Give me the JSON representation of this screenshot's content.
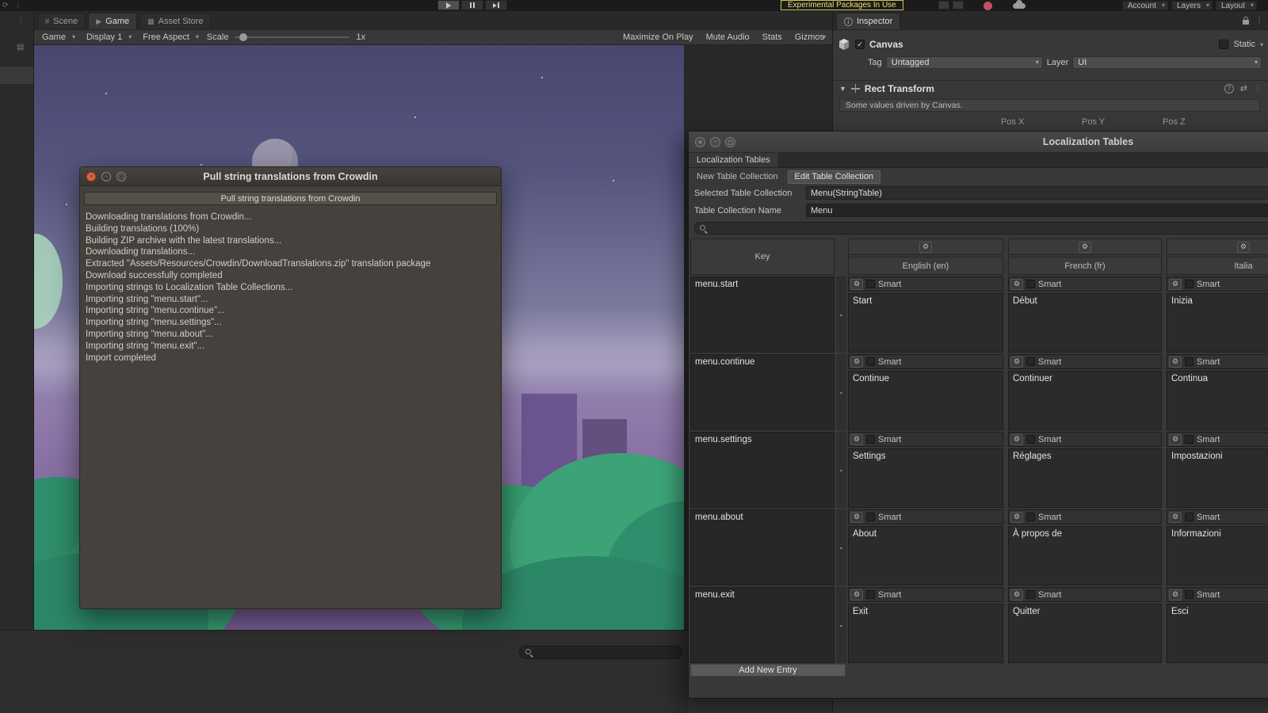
{
  "topbar": {
    "warning": "Experimental Packages In Use",
    "account": "Account",
    "layers": "Layers",
    "layout": "Layout"
  },
  "tabs": {
    "scene": "Scene",
    "game": "Game",
    "asset_store": "Asset Store"
  },
  "game_toolbar": {
    "game": "Game",
    "display": "Display 1",
    "aspect": "Free Aspect",
    "scale_label": "Scale",
    "scale_value": "1x",
    "maximize": "Maximize On Play",
    "mute": "Mute Audio",
    "stats": "Stats",
    "gizmos": "Gizmos"
  },
  "inspector": {
    "title": "Inspector",
    "object_name": "Canvas",
    "object_checked": "✓",
    "static_label": "Static",
    "tag_label": "Tag",
    "tag_value": "Untagged",
    "layer_label": "Layer",
    "layer_value": "UI",
    "component_title": "Rect Transform",
    "driven_note": "Some values driven by Canvas.",
    "pos_x": "Pos X",
    "pos_y": "Pos Y",
    "pos_z": "Pos Z"
  },
  "crowdin": {
    "title": "Pull string translations from Crowdin",
    "header_button": "Pull string translations from Crowdin",
    "log_lines": [
      "Downloading translations from Crowdin...",
      "Building translations (100%)",
      "Building ZIP archive with the latest translations...",
      "Downloading translations...",
      "Extracted \"Assets/Resources/Crowdin/DownloadTranslations.zip\" translation package",
      "Download successfully completed",
      "Importing strings to Localization Table Collections...",
      "Importing string \"menu.start\"...",
      "Importing string \"menu.continue\"...",
      "Importing string \"menu.settings\"...",
      "Importing string \"menu.about\"...",
      "Importing string \"menu.exit\"...",
      "Import completed"
    ]
  },
  "localization": {
    "title": "Localization Tables",
    "tab": "Localization Tables",
    "tab_new": "New Table Collection",
    "tab_edit": "Edit Table Collection",
    "selected_label": "Selected Table Collection",
    "selected_value": "Menu(StringTable)",
    "name_label": "Table Collection Name",
    "name_value": "Menu",
    "columns": [
      "Key",
      "English (en)",
      "French (fr)",
      "Italia"
    ],
    "smart_label": "Smart",
    "minus_label": "-",
    "add_button": "Add New Entry",
    "rows": [
      {
        "key": "menu.start",
        "en": "Start",
        "fr": "Début",
        "it": "Inizia"
      },
      {
        "key": "menu.continue",
        "en": "Continue",
        "fr": "Continuer",
        "it": "Continua"
      },
      {
        "key": "menu.settings",
        "en": "Settings",
        "fr": "Réglages",
        "it": "Impostazioni"
      },
      {
        "key": "menu.about",
        "en": "About",
        "fr": "À propos de",
        "it": "Informazioni"
      },
      {
        "key": "menu.exit",
        "en": "Exit",
        "fr": "Quitter",
        "it": "Esci"
      }
    ]
  },
  "colors": {
    "warning": "#e6dd7a",
    "close_button": "#dd6439",
    "sky_top": "#474770",
    "sky_horizon": "#a89fc0",
    "ground": "#745a92",
    "bush": "#36996f"
  }
}
